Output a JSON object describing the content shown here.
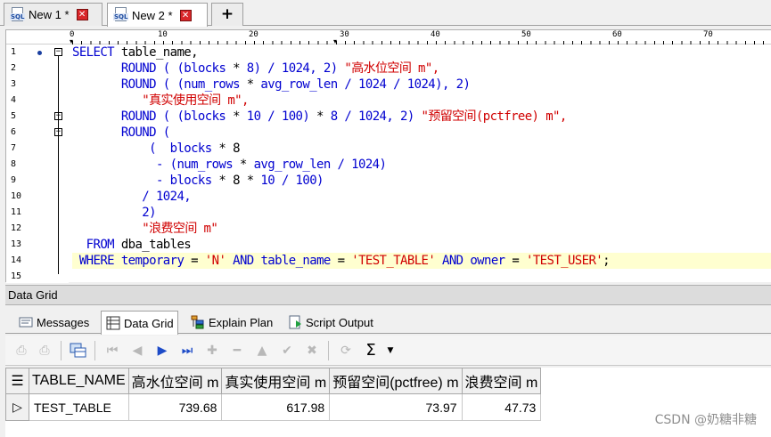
{
  "doc_tabs": [
    {
      "label": "New 1 *",
      "icon_text": "SQL",
      "active": false
    },
    {
      "label": "New 2 *",
      "icon_text": "SQL",
      "active": true
    }
  ],
  "add_tab_label": "+",
  "ruler": {
    "numbers": [
      "0",
      "10",
      "20",
      "30",
      "40",
      "50",
      "60",
      "70"
    ]
  },
  "editor": {
    "line_numbers": [
      "1",
      "2",
      "3",
      "4",
      "5",
      "6",
      "7",
      "8",
      "9",
      "10",
      "11",
      "12",
      "13",
      "14",
      "15"
    ],
    "lines": [
      [
        {
          "t": "SELECT ",
          "c": "kw"
        },
        {
          "t": "table_name,",
          "c": "id"
        }
      ],
      [
        {
          "t": "       ",
          "c": "id"
        },
        {
          "t": "ROUND",
          "c": "kw"
        },
        {
          "t": " ( (",
          "c": "kw"
        },
        {
          "t": "blocks",
          "c": "kw"
        },
        {
          "t": " * ",
          "c": "id"
        },
        {
          "t": "8) / 1024, 2) ",
          "c": "kw"
        },
        {
          "t": "\"高水位空间 m\",",
          "c": "str"
        }
      ],
      [
        {
          "t": "       ",
          "c": "id"
        },
        {
          "t": "ROUND ( (num_rows",
          "c": "kw"
        },
        {
          "t": " * ",
          "c": "id"
        },
        {
          "t": "avg_row_len / 1024 / 1024), 2)",
          "c": "kw"
        }
      ],
      [
        {
          "t": "          ",
          "c": "id"
        },
        {
          "t": "\"真实使用空间 m\",",
          "c": "str"
        }
      ],
      [
        {
          "t": "       ",
          "c": "id"
        },
        {
          "t": "ROUND ( (blocks",
          "c": "kw"
        },
        {
          "t": " * ",
          "c": "id"
        },
        {
          "t": "10 / 100) ",
          "c": "kw"
        },
        {
          "t": "* ",
          "c": "id"
        },
        {
          "t": "8 / 1024, 2) ",
          "c": "kw"
        },
        {
          "t": "\"预留空间(pctfree) m\",",
          "c": "str"
        }
      ],
      [
        {
          "t": "       ",
          "c": "id"
        },
        {
          "t": "ROUND (",
          "c": "kw"
        }
      ],
      [
        {
          "t": "           ",
          "c": "id"
        },
        {
          "t": "(  blocks",
          "c": "kw"
        },
        {
          "t": " * 8",
          "c": "id"
        }
      ],
      [
        {
          "t": "            ",
          "c": "id"
        },
        {
          "t": "- (num_rows",
          "c": "kw"
        },
        {
          "t": " * ",
          "c": "id"
        },
        {
          "t": "avg_row_len / 1024)",
          "c": "kw"
        }
      ],
      [
        {
          "t": "            ",
          "c": "id"
        },
        {
          "t": "- blocks",
          "c": "kw"
        },
        {
          "t": " * 8 * ",
          "c": "id"
        },
        {
          "t": "10 / 100)",
          "c": "kw"
        }
      ],
      [
        {
          "t": "          ",
          "c": "id"
        },
        {
          "t": "/ 1024,",
          "c": "kw"
        }
      ],
      [
        {
          "t": "          ",
          "c": "id"
        },
        {
          "t": "2)",
          "c": "kw"
        }
      ],
      [
        {
          "t": "          ",
          "c": "id"
        },
        {
          "t": "\"浪费空间 m\"",
          "c": "str"
        }
      ],
      [
        {
          "t": "  FROM ",
          "c": "kw"
        },
        {
          "t": "dba_tables",
          "c": "id"
        }
      ],
      [
        {
          "t": " WHERE ",
          "c": "kw"
        },
        {
          "t": "temporary",
          "c": "kw"
        },
        {
          "t": " = ",
          "c": "id"
        },
        {
          "t": "'N'",
          "c": "str"
        },
        {
          "t": " AND ",
          "c": "kw"
        },
        {
          "t": "table_name",
          "c": "kw"
        },
        {
          "t": " = ",
          "c": "id"
        },
        {
          "t": "'TEST_TABLE'",
          "c": "str"
        },
        {
          "t": " AND ",
          "c": "kw"
        },
        {
          "t": "owner",
          "c": "kw"
        },
        {
          "t": " = ",
          "c": "id"
        },
        {
          "t": "'TEST_USER'",
          "c": "str"
        },
        {
          "t": ";",
          "c": "id"
        }
      ],
      []
    ]
  },
  "panel_title": "Data Grid",
  "result_tabs": [
    {
      "label": "Messages",
      "icon": "messages-icon",
      "active": false
    },
    {
      "label": "Data Grid",
      "icon": "grid-icon",
      "active": true
    },
    {
      "label": "Explain Plan",
      "icon": "explain-plan-icon",
      "active": false
    },
    {
      "label": "Script Output",
      "icon": "script-output-icon",
      "active": false
    }
  ],
  "toolbar": {
    "icons": [
      "export-icon",
      "print-icon",
      "grid-options-icon",
      "first-record-icon",
      "prior-record-icon",
      "next-record-icon",
      "last-record-icon",
      "insert-record-icon",
      "delete-record-icon",
      "edit-record-icon",
      "post-edit-icon",
      "cancel-edit-icon",
      "refresh-icon",
      "sum-icon",
      "dropdown-arrow-icon"
    ],
    "sum_symbol": "Σ"
  },
  "grid": {
    "columns": [
      "TABLE_NAME",
      "高水位空间 m",
      "真实使用空间 m",
      "预留空间(pctfree) m",
      "浪费空间 m"
    ],
    "rows": [
      [
        "TEST_TABLE",
        "739.68",
        "617.98",
        "73.97",
        "47.73"
      ]
    ]
  },
  "watermark": "CSDN @奶糖非糖"
}
